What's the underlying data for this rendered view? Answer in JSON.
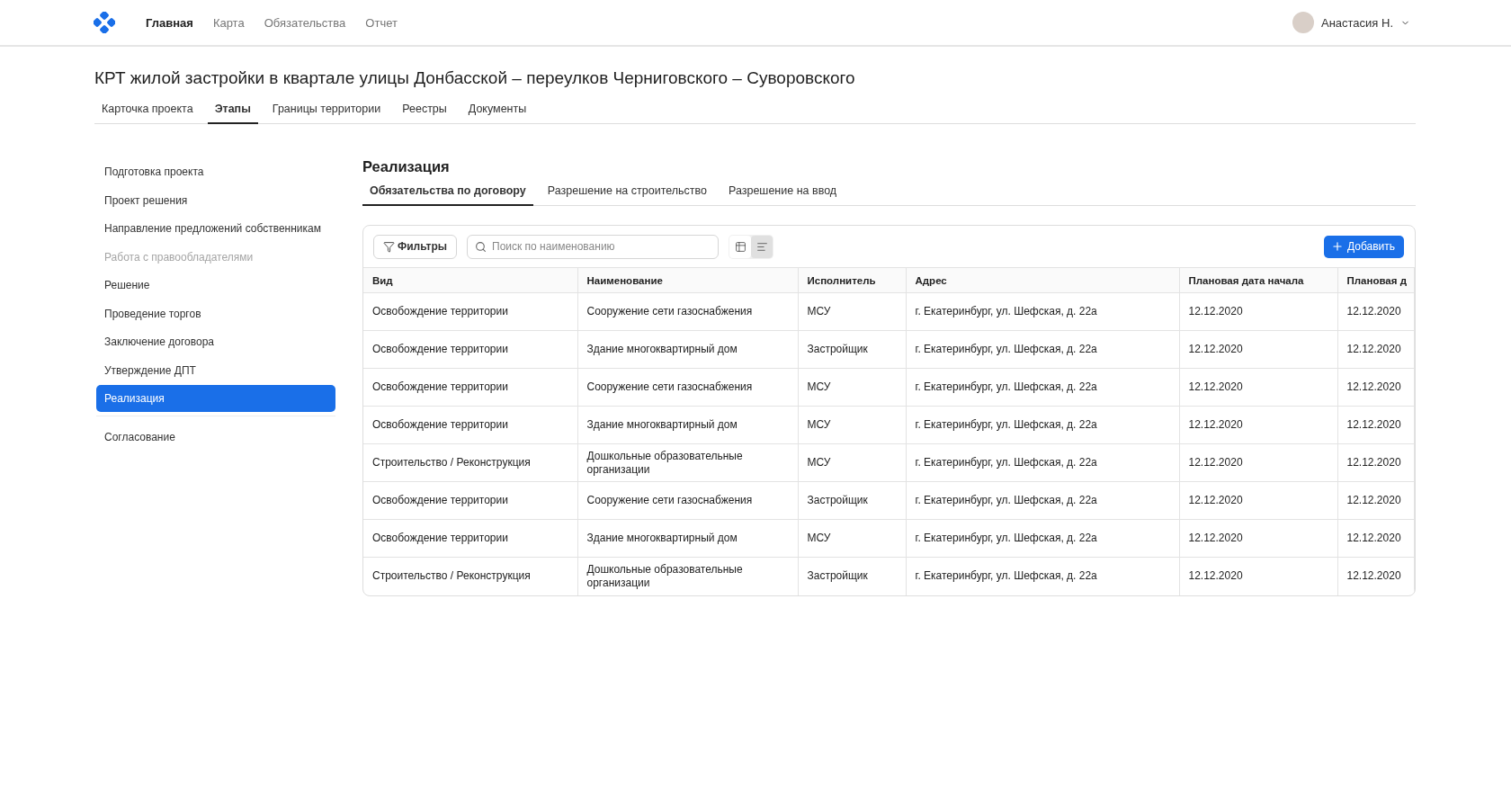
{
  "header": {
    "nav": [
      {
        "label": "Главная",
        "selected": true
      },
      {
        "label": "Карта",
        "selected": false
      },
      {
        "label": "Обязательства",
        "selected": false
      },
      {
        "label": "Отчет",
        "selected": false
      }
    ],
    "user": "Анастасия Н."
  },
  "title": "КРТ жилой застройки в квартале улицы Донбасской – переулков Черниговского – Суворовского",
  "tabs": [
    {
      "label": "Карточка проекта",
      "selected": false
    },
    {
      "label": "Этапы",
      "selected": true
    },
    {
      "label": "Границы территории",
      "selected": false
    },
    {
      "label": "Реестры",
      "selected": false
    },
    {
      "label": "Документы",
      "selected": false
    }
  ],
  "sidebar": {
    "items": [
      {
        "label": "Подготовка проекта",
        "selected": false,
        "disabled": false
      },
      {
        "label": "Проект решения",
        "selected": false,
        "disabled": false
      },
      {
        "label": "Направление предложений собственникам",
        "selected": false,
        "disabled": false
      },
      {
        "label": "Работа с правообладателями",
        "selected": false,
        "disabled": true
      },
      {
        "label": "Решение",
        "selected": false,
        "disabled": false
      },
      {
        "label": "Проведение торгов",
        "selected": false,
        "disabled": false
      },
      {
        "label": "Заключение договора",
        "selected": false,
        "disabled": false
      },
      {
        "label": "Утверждение ДПТ",
        "selected": false,
        "disabled": false
      },
      {
        "label": "Реализация",
        "selected": true,
        "disabled": false
      },
      {
        "label": "Согласование",
        "selected": false,
        "disabled": false
      }
    ]
  },
  "section": {
    "title": "Реализация",
    "subtabs": [
      {
        "label": "Обязательства по договору",
        "selected": true
      },
      {
        "label": "Разрешение на строительство",
        "selected": false
      },
      {
        "label": "Разрешение на ввод",
        "selected": false
      }
    ]
  },
  "toolbar": {
    "filters": "Фильтры",
    "search_placeholder": "Поиск по наименованию",
    "view_modes": [
      {
        "selected": false
      },
      {
        "selected": true
      }
    ],
    "add": "Добавить"
  },
  "table": {
    "columns": [
      "Вид",
      "Наименование",
      "Исполнитель",
      "Адрес",
      "Плановая дата начала",
      "Плановая д"
    ],
    "rows": [
      [
        "Освобождение территории",
        "Сооружение сети газоснабжения",
        "МСУ",
        "г. Екатеринбург, ул. Шефская, д. 22а",
        "12.12.2020",
        "12.12.2020"
      ],
      [
        "Освобождение территории",
        "Здание многоквартирный дом",
        "Застройщик",
        "г. Екатеринбург, ул. Шефская, д. 22а",
        "12.12.2020",
        "12.12.2020"
      ],
      [
        "Освобождение территории",
        "Сооружение сети газоснабжения",
        "МСУ",
        "г. Екатеринбург, ул. Шефская, д. 22а",
        "12.12.2020",
        "12.12.2020"
      ],
      [
        "Освобождение территории",
        "Здание многоквартирный дом",
        "МСУ",
        "г. Екатеринбург, ул. Шефская, д. 22а",
        "12.12.2020",
        "12.12.2020"
      ],
      [
        "Строительство / Реконструкция",
        "Дошкольные образовательные организации",
        "МСУ",
        "г. Екатеринбург, ул. Шефская, д. 22а",
        "12.12.2020",
        "12.12.2020"
      ],
      [
        "Освобождение территории",
        "Сооружение сети газоснабжения",
        "Застройщик",
        "г. Екатеринбург, ул. Шефская, д. 22а",
        "12.12.2020",
        "12.12.2020"
      ],
      [
        "Освобождение территории",
        "Здание многоквартирный дом",
        "МСУ",
        "г. Екатеринбург, ул. Шефская, д. 22а",
        "12.12.2020",
        "12.12.2020"
      ],
      [
        "Строительство / Реконструкция",
        "Дошкольные образовательные организации",
        "Застройщик",
        "г. Екатеринбург, ул. Шефская, д. 22а",
        "12.12.2020",
        "12.12.2020"
      ]
    ]
  }
}
